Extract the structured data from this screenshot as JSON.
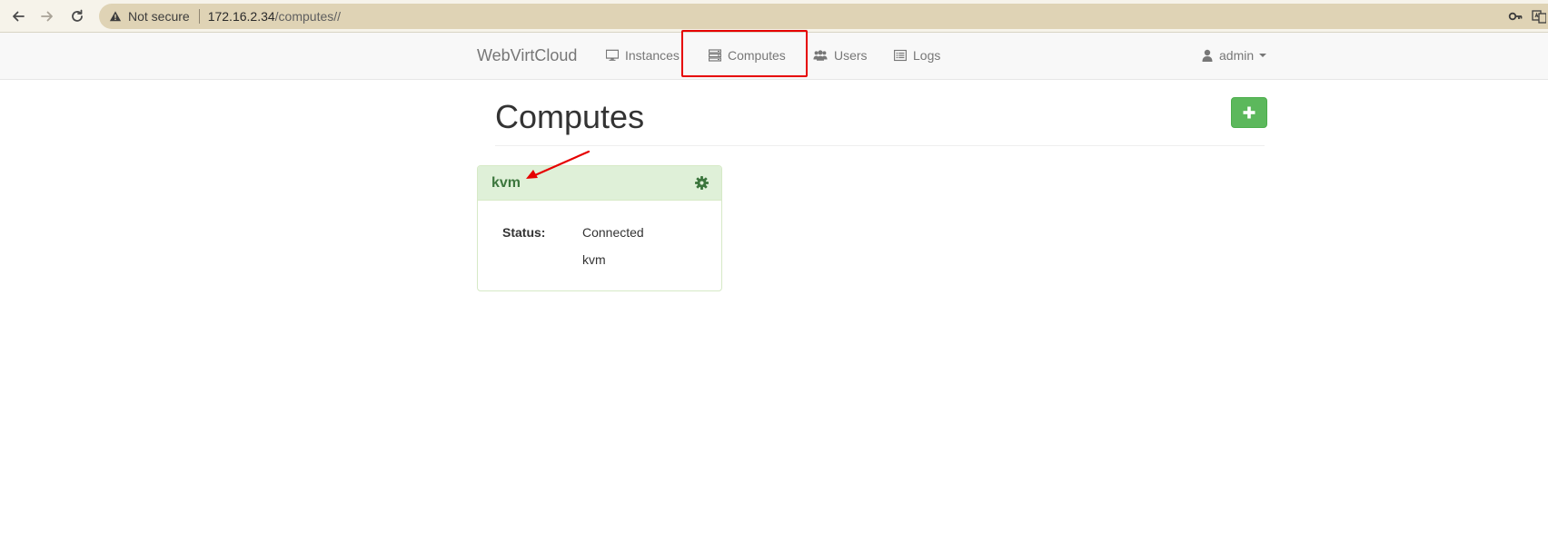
{
  "browser": {
    "security_label": "Not secure",
    "url_host": "172.16.2.34",
    "url_path": "/computes//",
    "icons": [
      "back-arrow-icon",
      "forward-arrow-icon",
      "reload-icon",
      "warning-icon",
      "key-icon",
      "translate-icon"
    ]
  },
  "navbar": {
    "brand": "WebVirtCloud",
    "items": [
      {
        "label": "Instances",
        "icon": "desktop-icon"
      },
      {
        "label": "Computes",
        "icon": "server-icon"
      },
      {
        "label": "Users",
        "icon": "users-icon"
      },
      {
        "label": "Logs",
        "icon": "list-icon"
      }
    ],
    "user": {
      "label": "admin",
      "icon": "user-icon"
    }
  },
  "page": {
    "title": "Computes",
    "add_button_icon": "plus-icon"
  },
  "computes": [
    {
      "name": "kvm",
      "status_label": "Status:",
      "status": "Connected",
      "details": "kvm"
    }
  ],
  "colors": {
    "success": "#5cb85c",
    "panel_heading": "#dff0d8",
    "panel_text": "#3c763d",
    "highlight": "#e60000"
  }
}
